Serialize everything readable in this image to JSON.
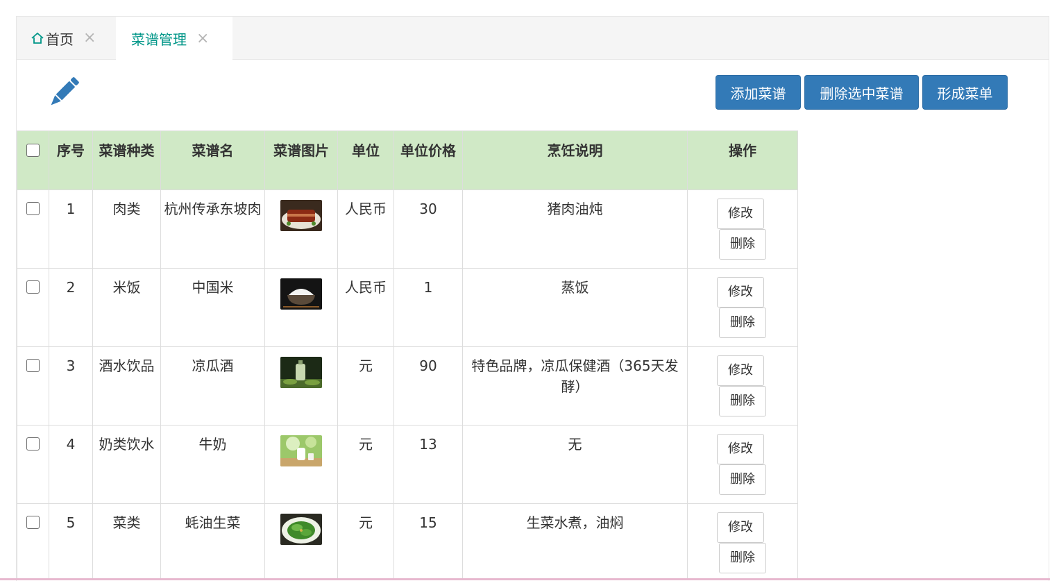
{
  "tabs": [
    {
      "label": "首页",
      "active": false
    },
    {
      "label": "菜谱管理",
      "active": true
    }
  ],
  "toolbar": {
    "add_label": "添加菜谱",
    "delete_selected_label": "删除选中菜谱",
    "form_menu_label": "形成菜单"
  },
  "table": {
    "headers": [
      "序号",
      "菜谱种类",
      "菜谱名",
      "菜谱图片",
      "单位",
      "单位价格",
      "烹饪说明",
      "操作"
    ],
    "rows": [
      {
        "index": "1",
        "category": "肉类",
        "name": "杭州传承东坡肉",
        "image": "dongpo-pork-icon",
        "unit": "人民币",
        "price": "30",
        "note": "猪肉油炖"
      },
      {
        "index": "2",
        "category": "米饭",
        "name": "中国米",
        "image": "rice-bowl-icon",
        "unit": "人民币",
        "price": "1",
        "note": "蒸饭"
      },
      {
        "index": "3",
        "category": "酒水饮品",
        "name": "凉瓜酒",
        "image": "bitter-melon-wine-icon",
        "unit": "元",
        "price": "90",
        "note": "特色品牌，凉瓜保健酒（365天发酵）"
      },
      {
        "index": "4",
        "category": "奶类饮水",
        "name": "牛奶",
        "image": "milk-icon",
        "unit": "元",
        "price": "13",
        "note": "无"
      },
      {
        "index": "5",
        "category": "菜类",
        "name": "蚝油生菜",
        "image": "lettuce-dish-icon",
        "unit": "元",
        "price": "15",
        "note": "生菜水煮，油焖"
      }
    ],
    "edit_label": "修改",
    "delete_label": "删除"
  },
  "colors": {
    "primary": "#337ab7",
    "active_tab": "#009688",
    "header_bg": "#d0e9c6"
  }
}
